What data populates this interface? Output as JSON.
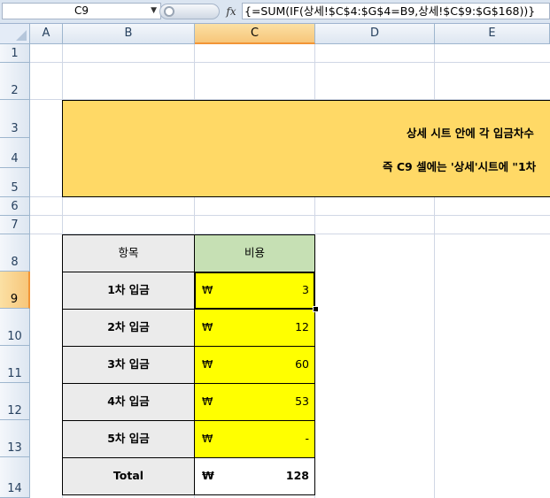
{
  "formula_bar": {
    "name_box": "C9",
    "fx_label": "fx",
    "formula": "{=SUM(IF(상세!$C$4:$G$4=B9,상세!$C$9:$G$168))}"
  },
  "columns": [
    "A",
    "B",
    "C",
    "D",
    "E"
  ],
  "rows": [
    "1",
    "2",
    "3",
    "4",
    "5",
    "6",
    "7",
    "8",
    "9",
    "10",
    "11",
    "12",
    "13",
    "14"
  ],
  "banner": {
    "line1": "상세 시트 안에 각 입금차수",
    "line2": "즉 C9 셀에는 '상세'시트에 \"1차"
  },
  "table": {
    "header_item": "항목",
    "header_cost": "비용",
    "currency": "₩",
    "rows": [
      {
        "label": "1차 입금",
        "value": "3"
      },
      {
        "label": "2차 입금",
        "value": "12"
      },
      {
        "label": "3차 입금",
        "value": "60"
      },
      {
        "label": "4차 입금",
        "value": "53"
      },
      {
        "label": "5차 입금",
        "value": "-"
      },
      {
        "label": "Total",
        "value": "128"
      }
    ]
  },
  "colors": {
    "banner": "#ffd966",
    "header_cost": "#c6e0b4",
    "value_fill": "#ffff00",
    "label_fill": "#ebebeb"
  }
}
